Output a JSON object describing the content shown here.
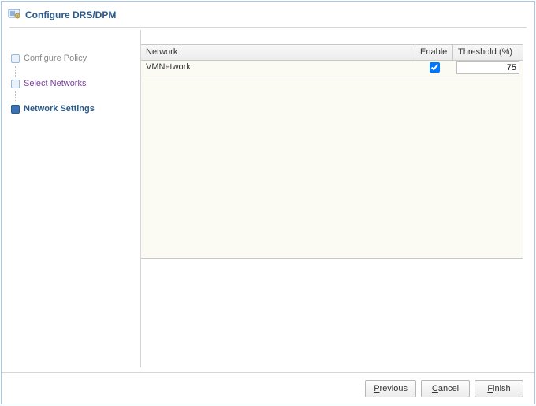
{
  "dialog": {
    "title": "Configure DRS/DPM"
  },
  "sidebar": {
    "steps": {
      "configure_policy": "Configure Policy",
      "select_networks": "Select Networks",
      "network_settings": "Network Settings"
    }
  },
  "grid": {
    "headers": {
      "network": "Network",
      "enable": "Enable",
      "threshold": "Threshold (%)"
    },
    "rows": [
      {
        "network": "VMNetwork",
        "enable": true,
        "threshold": "75"
      }
    ]
  },
  "footer": {
    "previous": "Previous",
    "cancel": "Cancel",
    "finish": "Finish"
  }
}
